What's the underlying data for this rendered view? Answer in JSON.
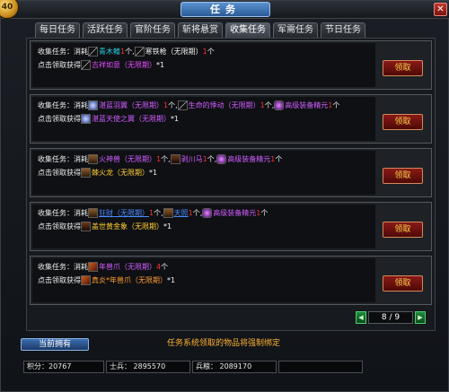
{
  "window": {
    "title": "任务",
    "logo_text": "40",
    "close_glyph": "✕"
  },
  "tabs": [
    {
      "label": "每日任务",
      "active": false
    },
    {
      "label": "活跃任务",
      "active": false
    },
    {
      "label": "官阶任务",
      "active": false
    },
    {
      "label": "斩将悬赏",
      "active": false
    },
    {
      "label": "收集任务",
      "active": true
    },
    {
      "label": "军需任务",
      "active": false
    },
    {
      "label": "节日任务",
      "active": false
    }
  ],
  "labels": {
    "collect": "收集任务：消耗",
    "reward": "点击领取获得",
    "claim_button": "领取"
  },
  "tasks": [
    {
      "costs": [
        {
          "icon": "blade",
          "name": "青木鳍",
          "name_color": "cyan",
          "count": "1",
          "suffix": "个"
        },
        {
          "icon": "blade",
          "name": "寒铁枪（无限期）",
          "name_color": "white",
          "count": "1",
          "suffix": "个"
        }
      ],
      "reward": {
        "icon": "blade",
        "name": "吉祥如意（无限期）",
        "name_color": "magenta",
        "count": "*1"
      }
    },
    {
      "costs": [
        {
          "icon": "wing",
          "name": "湛蓝羽翼（无限期）",
          "name_color": "purple",
          "count": "1",
          "suffix": "个"
        },
        {
          "icon": "blade",
          "name": "生命的悸动（无限期）",
          "name_color": "purple",
          "count": "1",
          "suffix": "个"
        },
        {
          "icon": "gem",
          "name": "高级装备精元",
          "name_color": "purple",
          "count": "1",
          "suffix": "个"
        }
      ],
      "reward": {
        "icon": "wing",
        "name": "湛蓝天使之翼（无限期）",
        "name_color": "purple",
        "count": "*1"
      }
    },
    {
      "costs": [
        {
          "icon": "figure",
          "name": "火神兽（无限期）",
          "name_color": "purple",
          "count": "1",
          "suffix": "个"
        },
        {
          "icon": "beast",
          "name": "剥川马",
          "name_color": "purple",
          "count": "1",
          "suffix": "个"
        },
        {
          "icon": "gem",
          "name": "高级装备精元",
          "name_color": "purple",
          "count": "1",
          "suffix": "个"
        }
      ],
      "reward": {
        "icon": "figure",
        "name": "棘火龙（无限期）",
        "name_color": "yellow",
        "count": "*1"
      }
    },
    {
      "costs": [
        {
          "icon": "figure",
          "name": "狂财（无限期）",
          "name_color": "blue",
          "count": "1",
          "suffix": "个"
        },
        {
          "icon": "figure",
          "name": "天照",
          "name_color": "blue",
          "count": "1",
          "suffix": "个"
        },
        {
          "icon": "gem",
          "name": "高级装备精元",
          "name_color": "purple",
          "count": "1",
          "suffix": "个"
        }
      ],
      "reward": {
        "icon": "beast",
        "name": "盖世黄金象（无限期）",
        "name_color": "yellow",
        "count": "*1"
      }
    },
    {
      "costs": [
        {
          "icon": "claw",
          "name": "年兽爪（无限期）",
          "name_color": "purple",
          "count": "4",
          "suffix": "个"
        }
      ],
      "reward": {
        "icon": "claw",
        "name": "真炎*年兽爪（无限期）",
        "name_color": "orange",
        "count": "*1"
      }
    }
  ],
  "pager": {
    "text": "8 / 9",
    "prev_glyph": "◀",
    "next_glyph": "▶"
  },
  "footer": {
    "owned_button": "当前拥有",
    "notice": "任务系统领取的物品将强制绑定",
    "stats": [
      {
        "label": "积分：20767"
      },
      {
        "label": "士兵： 2895570"
      },
      {
        "label": "兵粮： 2089170"
      },
      {
        "label": ""
      }
    ]
  },
  "colors": {
    "accent_title": "#2a5a97",
    "claim_button": "#8a1a16",
    "pager_button": "#1f8a3a",
    "notice": "#ffb233"
  }
}
